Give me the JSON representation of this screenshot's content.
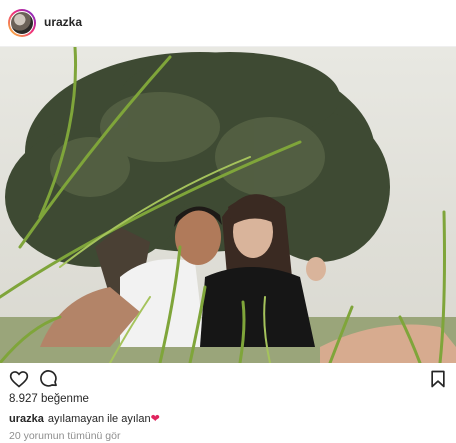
{
  "header": {
    "username": "urazka"
  },
  "post": {
    "likes_text": "8.927 beğenme",
    "caption_user": "urazka",
    "caption_text": "ayılamayan ile ayılan",
    "caption_emoji": "❤",
    "view_comments": "20 yorumun tümünü gör"
  },
  "icons": {
    "like": "heart-outline-icon",
    "comment": "comment-bubble-icon",
    "save": "bookmark-icon"
  },
  "colors": {
    "text": "#262626",
    "muted": "#8e8e8e",
    "heart": "#e0245e"
  }
}
